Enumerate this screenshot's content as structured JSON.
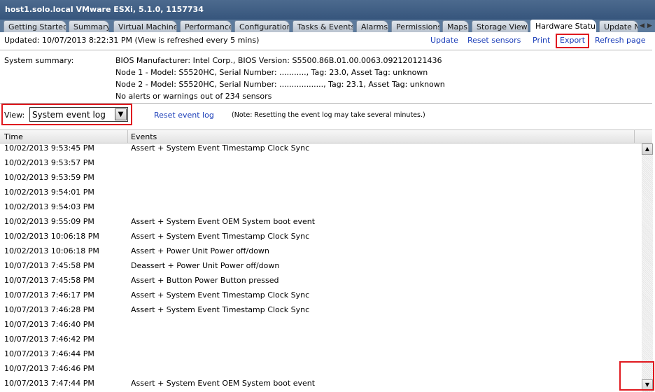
{
  "window": {
    "title": "host1.solo.local VMware ESXi, 5.1.0, 1157734"
  },
  "tabs": [
    {
      "label": "Getting Started",
      "active": false
    },
    {
      "label": "Summary",
      "active": false
    },
    {
      "label": "Virtual Machines",
      "active": false
    },
    {
      "label": "Performance",
      "active": false
    },
    {
      "label": "Configuration",
      "active": false
    },
    {
      "label": "Tasks & Events",
      "active": false
    },
    {
      "label": "Alarms",
      "active": false
    },
    {
      "label": "Permissions",
      "active": false
    },
    {
      "label": "Maps",
      "active": false
    },
    {
      "label": "Storage Views",
      "active": false
    },
    {
      "label": "Hardware Status",
      "active": true
    },
    {
      "label": "Update M",
      "active": false
    }
  ],
  "tab_nav": {
    "left_icon": "chevron-left-icon",
    "right_icon": "chevron-right-icon"
  },
  "status": {
    "updated": "Updated: 10/07/2013  8:22:31 PM (View is refreshed every 5 mins)"
  },
  "actions": {
    "update": "Update",
    "reset_sensors": "Reset sensors",
    "print": "Print",
    "export": "Export",
    "refresh_page": "Refresh page"
  },
  "summary": {
    "label": "System summary:",
    "lines": [
      "BIOS Manufacturer: Intel Corp., BIOS Version: S5500.86B.01.00.0063.092120121436",
      "Node 1 - Model: S5520HC, Serial Number: ..........., Tag: 23.0,  Asset Tag: unknown",
      "Node 2 - Model: S5520HC, Serial Number: .................., Tag: 23.1,  Asset Tag: unknown",
      "No alerts or warnings out of 234 sensors"
    ]
  },
  "view": {
    "label": "View:",
    "selected": "System event log",
    "reset_link": "Reset event log",
    "note": "(Note: Resetting the event log may take several minutes.)"
  },
  "grid": {
    "columns": [
      "Time",
      "Events"
    ],
    "rows": [
      {
        "time": "10/02/2013 9:53:45 PM",
        "event": "Assert + System Event Timestamp Clock Sync"
      },
      {
        "time": "10/02/2013 9:53:57 PM",
        "event": ""
      },
      {
        "time": "10/02/2013 9:53:59 PM",
        "event": ""
      },
      {
        "time": "10/02/2013 9:54:01 PM",
        "event": ""
      },
      {
        "time": "10/02/2013 9:54:03 PM",
        "event": ""
      },
      {
        "time": "10/02/2013 9:55:09 PM",
        "event": "Assert + System Event OEM System boot event"
      },
      {
        "time": "10/02/2013 10:06:18 PM",
        "event": "Assert + System Event Timestamp Clock Sync"
      },
      {
        "time": "10/02/2013 10:06:18 PM",
        "event": "Assert + Power Unit Power off/down"
      },
      {
        "time": "10/07/2013 7:45:58 PM",
        "event": "Deassert + Power Unit Power off/down"
      },
      {
        "time": "10/07/2013 7:45:58 PM",
        "event": "Assert + Button Power Button pressed"
      },
      {
        "time": "10/07/2013 7:46:17 PM",
        "event": "Assert + System Event Timestamp Clock Sync"
      },
      {
        "time": "10/07/2013 7:46:28 PM",
        "event": "Assert + System Event Timestamp Clock Sync"
      },
      {
        "time": "10/07/2013 7:46:40 PM",
        "event": ""
      },
      {
        "time": "10/07/2013 7:46:42 PM",
        "event": ""
      },
      {
        "time": "10/07/2013 7:46:44 PM",
        "event": ""
      },
      {
        "time": "10/07/2013 7:46:46 PM",
        "event": ""
      },
      {
        "time": "10/07/2013 7:47:44 PM",
        "event": "Assert + System Event OEM System boot event"
      }
    ]
  },
  "scrollbar": {
    "up_icon": "triangle-up-icon",
    "down_icon": "triangle-down-icon"
  },
  "colors": {
    "highlight": "#e0191f",
    "link": "#1a3db8",
    "titlebar": "#36557c"
  }
}
